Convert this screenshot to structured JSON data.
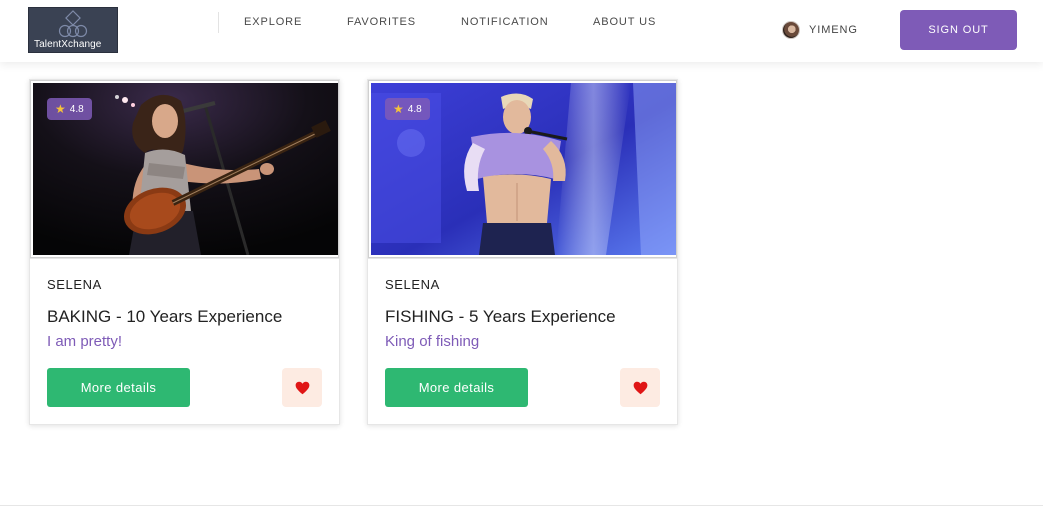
{
  "brand": {
    "logo_text": "TalentXchange"
  },
  "nav": {
    "items": [
      {
        "label": "EXPLORE"
      },
      {
        "label": "FAVORITES"
      },
      {
        "label": "NOTIFICATION"
      },
      {
        "label": "ABOUT US"
      }
    ]
  },
  "user": {
    "name": "YIMENG",
    "sign_out_label": "SIGN OUT"
  },
  "colors": {
    "accent_purple": "#7e5bb7",
    "button_green": "#2eb872",
    "favorite_red": "#e01616",
    "favorite_bg": "#fdebe2"
  },
  "cards": [
    {
      "rating": "4.8",
      "seller": "SELENA",
      "skill": "BAKING - 10 Years Experience",
      "tagline": "I am pretty!",
      "details_label": "More details",
      "image_icon": "guitarist-photo",
      "favorite_icon": "heart-icon"
    },
    {
      "rating": "4.8",
      "seller": "SELENA",
      "skill": "FISHING - 5 Years Experience",
      "tagline": "King of fishing",
      "details_label": "More details",
      "image_icon": "singer-photo",
      "favorite_icon": "heart-icon"
    }
  ]
}
